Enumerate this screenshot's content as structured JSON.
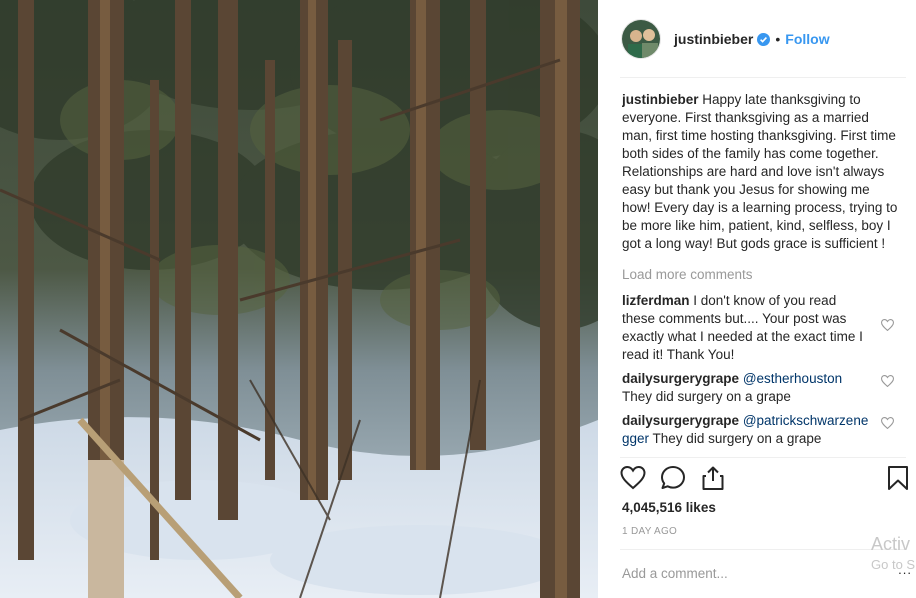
{
  "photo": {
    "alt": "snowy-forest-photo"
  },
  "header": {
    "username": "justinbieber",
    "verified_icon": "verified-badge-icon",
    "separator": "•",
    "follow_label": "Follow"
  },
  "caption": {
    "username": "justinbieber",
    "text": "Happy late thanksgiving to everyone. First thanksgiving as a married man, first time hosting thanksgiving. First time both sides of the family has come together. Relationships are hard and love isn't always easy but thank you Jesus for showing me how! Every day is a learning process, trying to be more like him, patient, kind, selfless, boy I got a long way! But gods grace is sufficient !"
  },
  "load_more_label": "Load more comments",
  "comments": [
    {
      "username": "lizferdman",
      "mention": "",
      "text": "I don't know of you read these comments but.... Your post was exactly what I needed at the exact time I read it! Thank You!"
    },
    {
      "username": "dailysurgerygrape",
      "mention": "@estherhouston",
      "text": "They did surgery on a grape"
    },
    {
      "username": "dailysurgerygrape",
      "mention": "@patrickschwarzenegger",
      "text": "They did surgery on a grape"
    }
  ],
  "actions": {
    "like_icon": "heart-icon",
    "comment_icon": "comment-bubble-icon",
    "share_icon": "share-icon",
    "save_icon": "bookmark-icon"
  },
  "likes": "4,045,516 likes",
  "time_ago": "1 DAY AGO",
  "add_comment_placeholder": "Add a comment...",
  "more_label": "...",
  "watermark": {
    "line1": "Activ",
    "line2": "Go to S"
  },
  "colors": {
    "link_blue": "#3897f0",
    "text": "#262626",
    "muted": "#999999",
    "divider": "#efefef"
  }
}
